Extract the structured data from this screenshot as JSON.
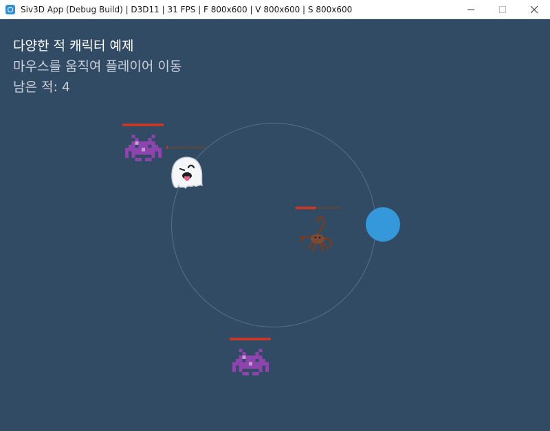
{
  "window": {
    "title": "Siv3D App (Debug Build) | D3D11 | 31 FPS | F 800x600 | V 800x600 | S 800x600",
    "controls": {
      "minimize": "—",
      "maximize": "☐",
      "close": "✕"
    }
  },
  "hud": {
    "title": "다양한 적 캐릭터 예제",
    "instruction": "마우스를 움직여 플레이어 이동",
    "remaining": "남은 적: 4"
  },
  "colors": {
    "background": "#324b64",
    "player": "#3498db",
    "hp_fill": "#c0392b",
    "hp_back": "#4a4a4a"
  },
  "player": {
    "icon": "player-circle"
  },
  "enemies": [
    {
      "type": "alien-monster",
      "icon": "alien-monster-icon",
      "hp": 1.0
    },
    {
      "type": "ghost",
      "icon": "ghost-icon",
      "hp": 0.04
    },
    {
      "type": "scorpion",
      "icon": "scorpion-icon",
      "hp": 0.45
    },
    {
      "type": "alien-monster",
      "icon": "alien-monster-icon",
      "hp": 1.0
    }
  ]
}
